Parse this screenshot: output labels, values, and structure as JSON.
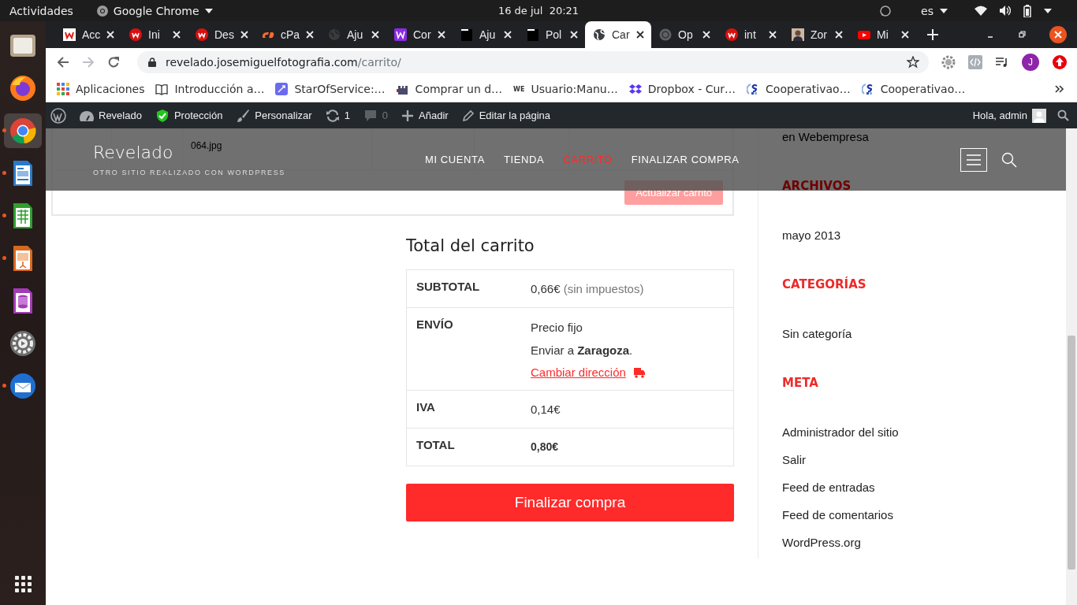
{
  "system_bar": {
    "activities": "Actividades",
    "app": "Google Chrome",
    "clock": "16 de jul  20:21",
    "language": "es"
  },
  "dock": {
    "apps": [
      {
        "kind": "files",
        "running": false,
        "selected": false
      },
      {
        "kind": "firefox",
        "running": false,
        "selected": false
      },
      {
        "kind": "chrome",
        "running": true,
        "selected": true
      },
      {
        "kind": "writer",
        "running": true,
        "selected": false
      },
      {
        "kind": "calc",
        "running": true,
        "selected": false
      },
      {
        "kind": "impress",
        "running": true,
        "selected": false
      },
      {
        "kind": "base",
        "running": false,
        "selected": false
      },
      {
        "kind": "settings",
        "running": false,
        "selected": false
      },
      {
        "kind": "thunderbird",
        "running": true,
        "selected": false
      }
    ]
  },
  "browser": {
    "tabs": [
      {
        "label": "Acc",
        "selected": false
      },
      {
        "label": "Ini",
        "selected": false
      },
      {
        "label": "Des",
        "selected": false
      },
      {
        "label": "cPa",
        "selected": false
      },
      {
        "label": "Aju",
        "selected": false
      },
      {
        "label": "Cor",
        "selected": false
      },
      {
        "label": "Aju",
        "selected": false
      },
      {
        "label": "Pol",
        "selected": false
      },
      {
        "label": "Car",
        "selected": true
      },
      {
        "label": "Op",
        "selected": false
      },
      {
        "label": "int",
        "selected": false
      },
      {
        "label": "Zor",
        "selected": false
      },
      {
        "label": "Mi",
        "selected": false
      }
    ],
    "forward_disabled": true,
    "address": {
      "host": "revelado.josemiguelfotografia.com",
      "path": "/carrito/"
    },
    "profile_initial": "J",
    "bookmarks": [
      {
        "label": "Aplicaciones"
      },
      {
        "label": "Introducción a…"
      },
      {
        "label": "StarOfService:…"
      },
      {
        "label": "Comprar un d…"
      },
      {
        "label": "Usuario:Manu…",
        "favicon_text": "WE"
      },
      {
        "label": "Dropbox - Cur…"
      },
      {
        "label": "Cooperativao…"
      },
      {
        "label": "Cooperativao…"
      }
    ]
  },
  "admin_bar": {
    "items": [
      {
        "kind": "wp",
        "disabled": false
      },
      {
        "kind": "dashboard",
        "label": "Revelado",
        "disabled": false
      },
      {
        "kind": "shield",
        "label": "Protección",
        "disabled": false
      },
      {
        "kind": "brush",
        "label": "Personalizar",
        "disabled": false
      },
      {
        "kind": "updates",
        "label": "1",
        "disabled": false
      },
      {
        "kind": "comments",
        "label": "0",
        "disabled": true
      },
      {
        "kind": "plus",
        "label": "Añadir",
        "disabled": false
      },
      {
        "kind": "pencil",
        "label": "Editar la página",
        "disabled": false
      }
    ],
    "greeting": "Hola, admin"
  },
  "site_header": {
    "title": "Revelado",
    "tagline": "OTRO SITIO REALIZADO CON WORDPRESS",
    "menu": [
      {
        "label": "MI CUENTA",
        "selected": false
      },
      {
        "label": "TIENDA",
        "selected": false
      },
      {
        "label": "CARRITO",
        "selected": true
      },
      {
        "label": "FINALIZAR COMPRA",
        "selected": false
      }
    ]
  },
  "cart_table": {
    "file": "064.jpg",
    "update_button": "Actualizar carrito",
    "update_disabled": true
  },
  "cart_totals": {
    "title": "Total del carrito",
    "rows": [
      {
        "label": "SUBTOTAL",
        "kind": "amount",
        "value": "0,66€",
        "note": "(sin impuestos)"
      },
      {
        "label": "ENVÍO",
        "kind": "shipping",
        "method": "Precio fijo",
        "destination": "Enviar a **Zaragoza**.",
        "link": "Cambiar dirección"
      },
      {
        "label": "IVA",
        "kind": "amount",
        "value": "0,14€"
      },
      {
        "label": "TOTAL",
        "kind": "total",
        "value": "0,80€"
      }
    ],
    "checkout_button": "Finalizar compra"
  },
  "sidebar": {
    "intro": "en Webempresa",
    "sections": [
      {
        "heading": "ARCHIVOS",
        "links": [
          "mayo 2013"
        ]
      },
      {
        "heading": "CATEGORÍAS",
        "links": [
          "Sin categoría"
        ]
      },
      {
        "heading": "META",
        "links": [
          "Administrador del sitio",
          "Salir",
          "Feed de entradas",
          "Feed de comentarios",
          "WordPress.org"
        ]
      }
    ]
  }
}
